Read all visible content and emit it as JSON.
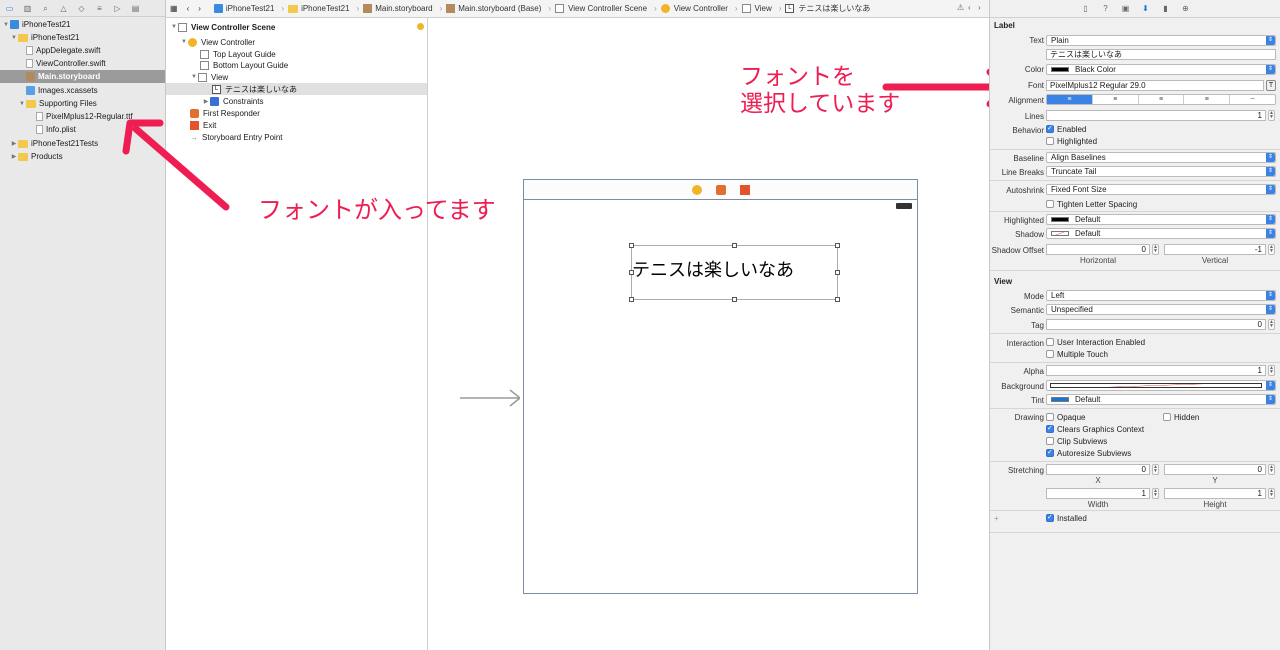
{
  "navigator": {
    "items": [
      {
        "label": "iPhoneTest21",
        "kind": "project"
      },
      {
        "label": "iPhoneTest21",
        "kind": "folder"
      },
      {
        "label": "AppDelegate.swift",
        "kind": "swift"
      },
      {
        "label": "ViewController.swift",
        "kind": "swift"
      },
      {
        "label": "Main.storyboard",
        "kind": "storyboard"
      },
      {
        "label": "Images.xcassets",
        "kind": "assets"
      },
      {
        "label": "Supporting Files",
        "kind": "folder"
      },
      {
        "label": "PixelMplus12-Regular.ttf",
        "kind": "file"
      },
      {
        "label": "Info.plist",
        "kind": "file"
      },
      {
        "label": "iPhoneTest21Tests",
        "kind": "folder"
      },
      {
        "label": "Products",
        "kind": "folder"
      }
    ]
  },
  "jumpbar": {
    "items": [
      "iPhoneTest21",
      "iPhoneTest21",
      "Main.storyboard",
      "Main.storyboard (Base)",
      "View Controller Scene",
      "View Controller",
      "View",
      "テニスは楽しいなあ"
    ]
  },
  "outline": {
    "items": [
      {
        "label": "View Controller Scene"
      },
      {
        "label": "View Controller"
      },
      {
        "label": "Top Layout Guide"
      },
      {
        "label": "Bottom Layout Guide"
      },
      {
        "label": "View"
      },
      {
        "label": "テニスは楽しいなあ"
      },
      {
        "label": "Constraints"
      },
      {
        "label": "First Responder"
      },
      {
        "label": "Exit"
      },
      {
        "label": "Storyboard Entry Point"
      }
    ]
  },
  "canvas": {
    "label_text": "テニスは楽しいなあ"
  },
  "annotations": {
    "font_added": "フォントが入ってます",
    "font_selected_line1": "フォントを",
    "font_selected_line2": "選択しています",
    "color": "#ee1d52"
  },
  "inspector": {
    "label_section": "Label",
    "text_label": "Text",
    "text_value": "Plain",
    "text_content": "テニスは楽しいなあ",
    "color_label": "Color",
    "color_value": "Black Color",
    "font_label": "Font",
    "font_value": "PixelMplus12 Regular 29.0",
    "alignment_label": "Alignment",
    "lines_label": "Lines",
    "lines_value": "1",
    "behavior_label": "Behavior",
    "enabled_label": "Enabled",
    "highlighted_label": "Highlighted",
    "baseline_label": "Baseline",
    "baseline_value": "Align Baselines",
    "line_breaks_label": "Line Breaks",
    "line_breaks_value": "Truncate Tail",
    "autoshrink_label": "Autoshrink",
    "autoshrink_value": "Fixed Font Size",
    "tighten_label": "Tighten Letter Spacing",
    "highlighted_color_label": "Highlighted",
    "highlighted_color_value": "Default",
    "shadow_label": "Shadow",
    "shadow_value": "Default",
    "shadow_offset_label": "Shadow Offset",
    "shadow_offset_h": "0",
    "shadow_offset_v": "-1",
    "horizontal_label": "Horizontal",
    "vertical_label": "Vertical",
    "view_section": "View",
    "mode_label": "Mode",
    "mode_value": "Left",
    "semantic_label": "Semantic",
    "semantic_value": "Unspecified",
    "tag_label": "Tag",
    "tag_value": "0",
    "interaction_label": "Interaction",
    "user_interaction_label": "User Interaction Enabled",
    "multiple_touch_label": "Multiple Touch",
    "alpha_label": "Alpha",
    "alpha_value": "1",
    "background_label": "Background",
    "tint_label": "Tint",
    "tint_value": "Default",
    "drawing_label": "Drawing",
    "opaque_label": "Opaque",
    "hidden_label": "Hidden",
    "clears_label": "Clears Graphics Context",
    "clip_label": "Clip Subviews",
    "autoresize_label": "Autoresize Subviews",
    "stretching_label": "Stretching",
    "stretch_x": "0",
    "stretch_y": "0",
    "stretch_w": "1",
    "stretch_h": "1",
    "x_label": "X",
    "y_label": "Y",
    "width_label": "Width",
    "height_label": "Height",
    "installed_label": "Installed",
    "plus_label": "+"
  }
}
